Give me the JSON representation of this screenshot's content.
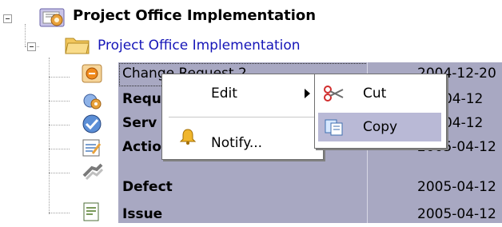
{
  "tree": {
    "root": {
      "label": "Project Office Implementation",
      "icon": "project-gear-icon"
    },
    "project": {
      "label": "Project Office Implementation",
      "icon": "folder-open-icon"
    },
    "items": [
      {
        "label": "Change Request 2",
        "icon": "change-request-icon",
        "date": "2004-12-20",
        "bold": false
      },
      {
        "label": "Requ",
        "icon": "requirement-icon",
        "date": "5-04-12",
        "bold": true
      },
      {
        "label": "Serv",
        "icon": "service-icon",
        "date": "5-04-12",
        "bold": true
      },
      {
        "label": "Action",
        "icon": "action-icon",
        "date": "2005-04-12",
        "bold": true
      },
      {
        "label": "Defect",
        "icon": "defect-icon",
        "date": "2005-04-12",
        "bold": true
      },
      {
        "label": "Issue",
        "icon": "issue-icon",
        "date": "2005-04-12",
        "bold": true
      }
    ]
  },
  "context_menu": {
    "items": [
      {
        "label": "Edit",
        "has_submenu": true
      },
      {
        "label": "Notify...",
        "icon": "bell-icon"
      }
    ]
  },
  "submenu": {
    "items": [
      {
        "label": "Cut",
        "icon": "scissors-icon"
      },
      {
        "label": "Copy",
        "icon": "copy-icon",
        "highlighted": true
      }
    ]
  },
  "colors": {
    "selection": "#a8a8c2",
    "link_blue": "#1515b8",
    "menu_highlight": "#b9b9d6"
  }
}
